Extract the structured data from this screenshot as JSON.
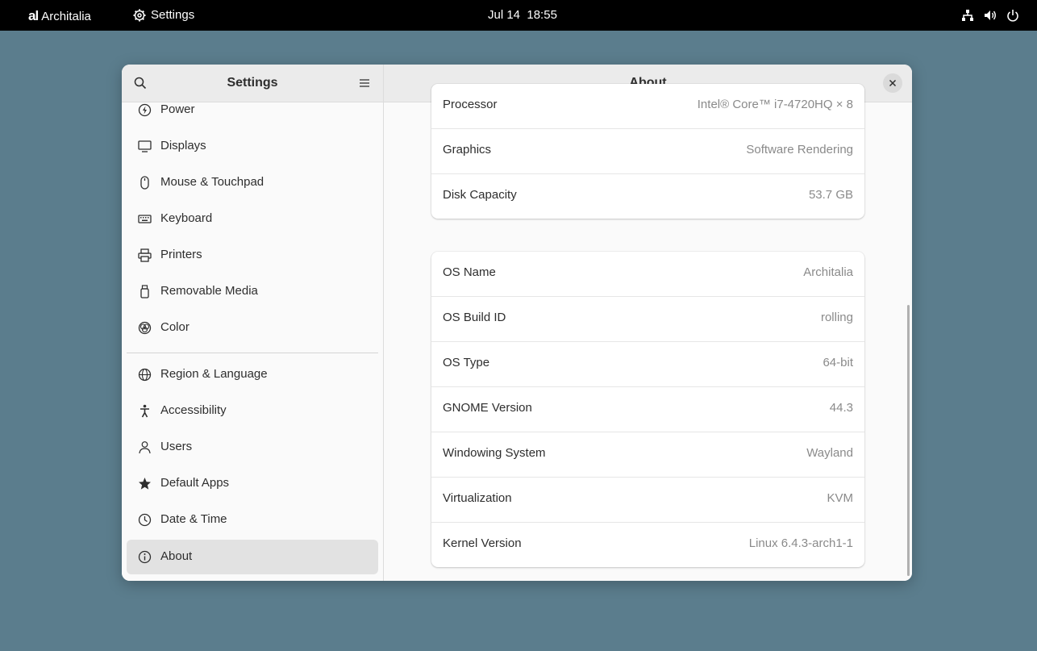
{
  "topbar": {
    "logo_mark": "al",
    "logo_text": "Architalia",
    "app_name": "Settings",
    "date": "Jul 14",
    "time": "18:55",
    "tray_icons": [
      "network-icon",
      "volume-icon",
      "power-icon"
    ]
  },
  "sidebar": {
    "title": "Settings",
    "items": [
      {
        "label": "Power",
        "icon": "power-icon"
      },
      {
        "label": "Displays",
        "icon": "display-icon"
      },
      {
        "label": "Mouse & Touchpad",
        "icon": "mouse-icon"
      },
      {
        "label": "Keyboard",
        "icon": "keyboard-icon"
      },
      {
        "label": "Printers",
        "icon": "printer-icon"
      },
      {
        "label": "Removable Media",
        "icon": "removable-media-icon"
      },
      {
        "label": "Color",
        "icon": "color-icon"
      },
      {
        "label": "Region & Language",
        "icon": "globe-icon"
      },
      {
        "label": "Accessibility",
        "icon": "accessibility-icon"
      },
      {
        "label": "Users",
        "icon": "users-icon"
      },
      {
        "label": "Default Apps",
        "icon": "star-icon"
      },
      {
        "label": "Date & Time",
        "icon": "clock-icon"
      },
      {
        "label": "About",
        "icon": "info-icon",
        "active": true
      }
    ]
  },
  "main": {
    "title": "About",
    "hardware": [
      {
        "label": "Processor",
        "value": "Intel® Core™ i7-4720HQ × 8"
      },
      {
        "label": "Graphics",
        "value": "Software Rendering"
      },
      {
        "label": "Disk Capacity",
        "value": "53.7 GB"
      }
    ],
    "software": [
      {
        "label": "OS Name",
        "value": "Architalia"
      },
      {
        "label": "OS Build ID",
        "value": "rolling"
      },
      {
        "label": "OS Type",
        "value": "64-bit"
      },
      {
        "label": "GNOME Version",
        "value": "44.3"
      },
      {
        "label": "Windowing System",
        "value": "Wayland"
      },
      {
        "label": "Virtualization",
        "value": "KVM"
      },
      {
        "label": "Kernel Version",
        "value": "Linux 6.4.3-arch1-1"
      }
    ]
  },
  "colors": {
    "desktop": "#5b7d8d",
    "topbar": "#000000",
    "window": "#fafafa",
    "active_item": "#e2e2e2"
  }
}
